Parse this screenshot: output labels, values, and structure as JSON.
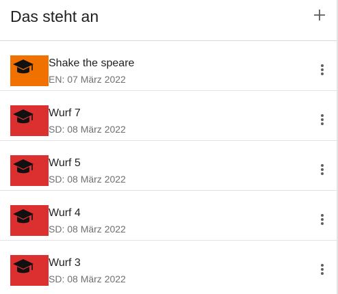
{
  "header": {
    "title": "Das steht an"
  },
  "colors": {
    "orange": "#f07000",
    "red": "#dc2f2f"
  },
  "items": [
    {
      "title": "Shake the speare",
      "subtitle": "EN: 07 März 2022",
      "icon": "graduation-cap-icon",
      "color": "#f07000"
    },
    {
      "title": "Wurf 7",
      "subtitle": "SD: 08 März 2022",
      "icon": "graduation-cap-icon",
      "color": "#dc2f2f"
    },
    {
      "title": "Wurf 5",
      "subtitle": "SD: 08 März 2022",
      "icon": "graduation-cap-icon",
      "color": "#dc2f2f"
    },
    {
      "title": "Wurf 4",
      "subtitle": "SD: 08 März 2022",
      "icon": "graduation-cap-icon",
      "color": "#dc2f2f"
    },
    {
      "title": "Wurf 3",
      "subtitle": "SD: 08 März 2022",
      "icon": "graduation-cap-icon",
      "color": "#dc2f2f"
    }
  ]
}
